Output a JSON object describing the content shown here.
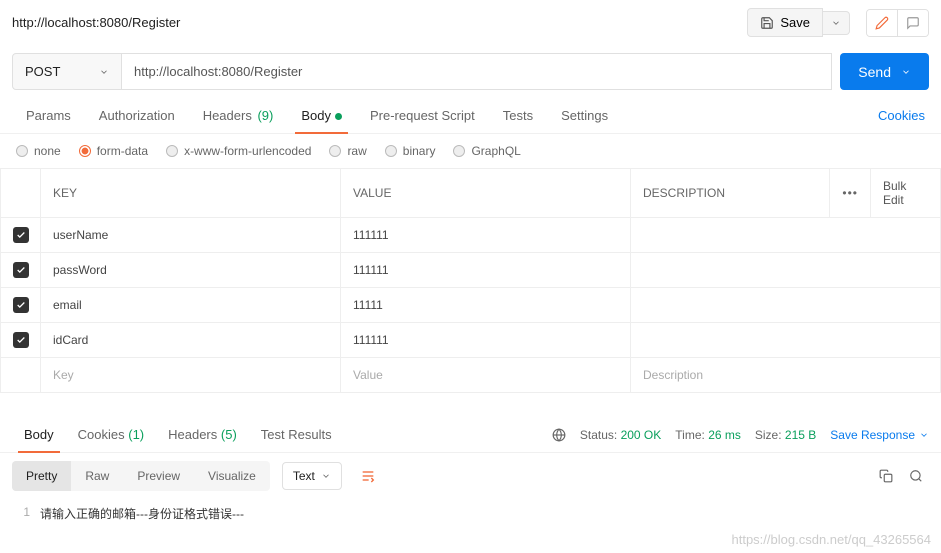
{
  "topbar": {
    "breadcrumb": "http://localhost:8080/Register",
    "save_label": "Save"
  },
  "request": {
    "method": "POST",
    "url": "http://localhost:8080/Register",
    "send_label": "Send"
  },
  "tabs": {
    "params": "Params",
    "authorization": "Authorization",
    "headers": "Headers",
    "headers_count": "(9)",
    "body": "Body",
    "prerequest": "Pre-request Script",
    "tests": "Tests",
    "settings": "Settings",
    "cookies": "Cookies"
  },
  "body_types": {
    "none": "none",
    "formdata": "form-data",
    "xwww": "x-www-form-urlencoded",
    "raw": "raw",
    "binary": "binary",
    "graphql": "GraphQL"
  },
  "table": {
    "headers": {
      "key": "KEY",
      "value": "VALUE",
      "description": "DESCRIPTION",
      "bulk": "Bulk Edit"
    },
    "rows": [
      {
        "key": "userName",
        "value": "111111"
      },
      {
        "key": "passWord",
        "value": "111111"
      },
      {
        "key": "email",
        "value": "11111"
      },
      {
        "key": "idCard",
        "value": "111111"
      }
    ],
    "placeholders": {
      "key": "Key",
      "value": "Value",
      "description": "Description"
    }
  },
  "response": {
    "tabs": {
      "body": "Body",
      "cookies": "Cookies",
      "cookies_count": "(1)",
      "headers": "Headers",
      "headers_count": "(5)",
      "tests": "Test Results"
    },
    "status_label": "Status:",
    "status_value": "200 OK",
    "time_label": "Time:",
    "time_value": "26 ms",
    "size_label": "Size:",
    "size_value": "215 B",
    "save_response": "Save Response",
    "views": {
      "pretty": "Pretty",
      "raw": "Raw",
      "preview": "Preview",
      "visualize": "Visualize"
    },
    "format": "Text",
    "line_no": "1",
    "body_text": "请输入正确的邮箱---身份证格式错误---"
  },
  "watermark": "https://blog.csdn.net/qq_43265564"
}
